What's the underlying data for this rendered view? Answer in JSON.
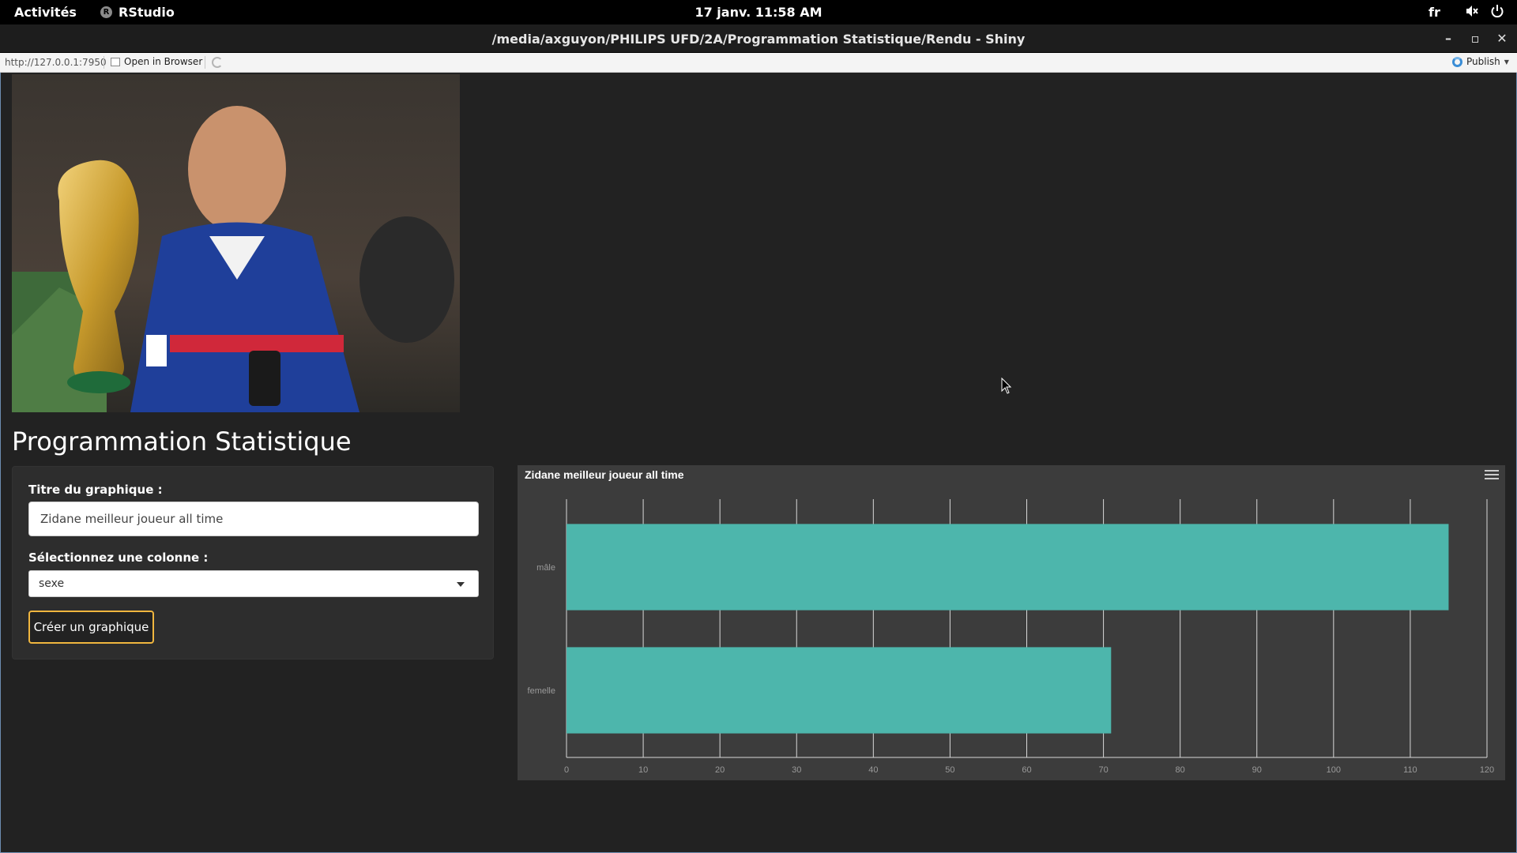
{
  "topbar": {
    "activities": "Activités",
    "app_name": "RStudio",
    "app_icon_letter": "R",
    "clock": "17 janv.  11:58 AM",
    "lang": "fr",
    "icons": [
      "volume-muted-icon",
      "power-icon"
    ]
  },
  "window": {
    "title": "/media/axguyon/PHILIPS UFD/2A/Programmation Statistique/Rendu - Shiny"
  },
  "viewer": {
    "url": "http://127.0.0.1:7950",
    "open_in_browser": "Open in Browser",
    "publish": "Publish"
  },
  "app": {
    "title": "Programmation Statistique",
    "form": {
      "title_label": "Titre du graphique :",
      "title_value": "Zidane meilleur joueur all time",
      "column_label": "Sélectionnez une colonne :",
      "column_value": "sexe",
      "create_button": "Créer un graphique"
    }
  },
  "chart_data": {
    "type": "bar",
    "orientation": "horizontal",
    "title": "Zidane meilleur joueur all time",
    "categories": [
      "mâle",
      "femelle"
    ],
    "values": [
      115,
      71
    ],
    "xlim": [
      0,
      120
    ],
    "xticks": [
      0,
      10,
      20,
      30,
      40,
      50,
      60,
      70,
      80,
      90,
      100,
      110,
      120
    ],
    "grid": true,
    "bar_color": "#4db6ac",
    "background": "#3c3c3c"
  }
}
